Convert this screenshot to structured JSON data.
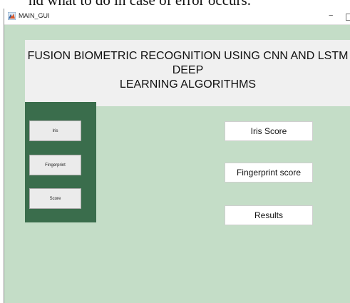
{
  "document": {
    "partial_text": "nd what to do in case of error occurs."
  },
  "window": {
    "title": "MAIN_GUI",
    "minimize_glyph": "−"
  },
  "banner": {
    "title_line1": "FUSION  BIOMETRIC RECOGNITION USING CNN AND LSTM DEEP",
    "title_line2": "LEARNING ALGORITHMS"
  },
  "panel": {
    "buttons": [
      {
        "label": "Iris"
      },
      {
        "label": "Fingerprint"
      },
      {
        "label": "Score"
      }
    ]
  },
  "results": {
    "iris_score_label": "Iris Score",
    "fingerprint_score_label": "Fingerprint score",
    "results_label": "Results"
  },
  "colors": {
    "window_background": "#c4ddc7",
    "panel_background": "#3a6d4c",
    "banner_background": "#f0f0f0"
  }
}
